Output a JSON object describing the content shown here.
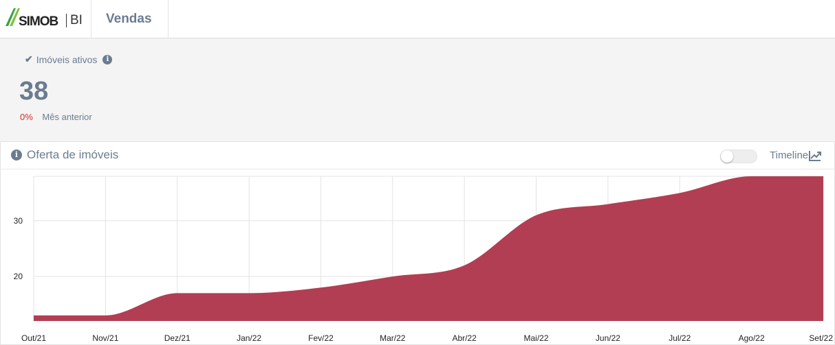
{
  "header": {
    "logo_text": "SIMOB",
    "logo_suffix": "BI",
    "page_title": "Vendas"
  },
  "kpi": {
    "label": "Imóveis ativos",
    "value": "38",
    "change_pct": "0%",
    "change_ref": "Mês anterior"
  },
  "card": {
    "title": "Oferta de imóveis",
    "timeline_label": "Timeline",
    "timeline_enabled": false
  },
  "colors": {
    "accent": "#b03a50",
    "text_muted": "#6b7c8f",
    "negative": "#e0242b",
    "logo_green": "#3da43d"
  },
  "icons": [
    "check-icon",
    "info-icon",
    "chart-line-icon"
  ],
  "chart_data": {
    "type": "area",
    "categories": [
      "Out/21",
      "Nov/21",
      "Dez/21",
      "Jan/22",
      "Fev/22",
      "Mar/22",
      "Abr/22",
      "Mai/22",
      "Jun/22",
      "Jul/22",
      "Ago/22",
      "Set/22"
    ],
    "series": [
      {
        "values": [
          13,
          13,
          17,
          17,
          18,
          20,
          22,
          31,
          33,
          35,
          38,
          38
        ]
      }
    ],
    "y_ticks": [
      20,
      30
    ],
    "ylim": [
      12,
      38
    ],
    "grid": true,
    "color": "#b03a50"
  }
}
